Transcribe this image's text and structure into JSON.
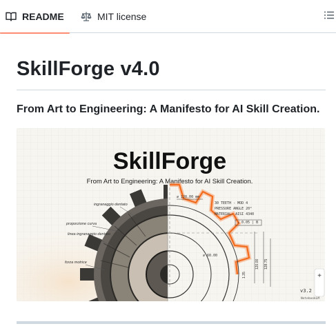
{
  "tabs": [
    {
      "label": "README",
      "icon": "book-icon",
      "active": true
    },
    {
      "label": "MIT license",
      "icon": "scale-icon",
      "active": false
    }
  ],
  "toc": {
    "icon": "list-icon"
  },
  "readme": {
    "title": "SkillForge v4.0",
    "subtitle": "From Art to Engineering: A Manifesto for AI Skill Creation.",
    "hero": {
      "heading": "SkillForge",
      "tagline": "From Art to Engineering: A Manifesto for AI Skill Creation.",
      "notes_left": [
        "ingranaggio dentato",
        "proporzione curva",
        "linea ingranaggio dentato",
        "forza motrice"
      ],
      "dim_top": "⌀ 120.00 mm",
      "spec_lines": [
        "30 TEETH - MOD 4",
        "PRESSURE ANGLE 20°",
        "MATERIAL: AISI 4340"
      ],
      "tolerance_box": "⊥ 0.05 | B",
      "dim_right_a": "120.00",
      "dim_right_b": "128.75",
      "dim_left_a": "1.35",
      "inner_dim": "⌀ 60.00",
      "version": "v3.2",
      "watermark": "NotebookLM",
      "zoom_label": "+"
    }
  },
  "colors": {
    "accent": "#fd8c73",
    "glow": "#f36b1c",
    "border": "#d1d9e0"
  }
}
